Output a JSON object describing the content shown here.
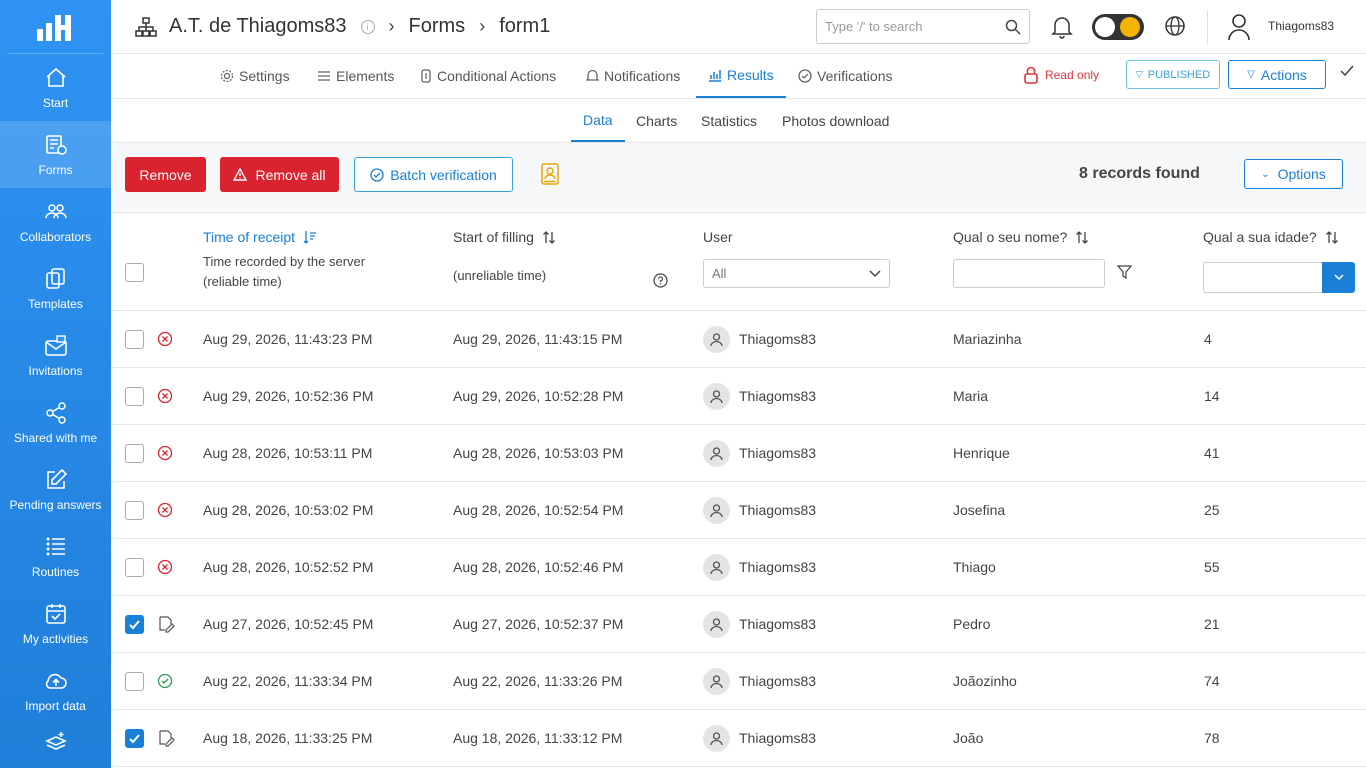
{
  "sidebar": {
    "items": [
      {
        "label": "Start",
        "icon": "home-icon"
      },
      {
        "label": "Forms",
        "icon": "forms-icon"
      },
      {
        "label": "Collaborators",
        "icon": "collaborators-icon"
      },
      {
        "label": "Templates",
        "icon": "templates-icon"
      },
      {
        "label": "Invitations",
        "icon": "invitations-icon"
      },
      {
        "label": "Shared with me",
        "icon": "share-icon"
      },
      {
        "label": "Pending answers",
        "icon": "edit-icon"
      },
      {
        "label": "Routines",
        "icon": "routines-icon"
      },
      {
        "label": "My activities",
        "icon": "calendar-icon"
      },
      {
        "label": "Import data",
        "icon": "cloud-upload-icon"
      }
    ]
  },
  "header": {
    "org": "A.T. de Thiagoms83",
    "crumb1": "Forms",
    "crumb2": "form1",
    "search_placeholder": "Type '/' to search",
    "username": "Thiagoms83"
  },
  "tabs": [
    {
      "label": "Settings"
    },
    {
      "label": "Elements"
    },
    {
      "label": "Conditional Actions"
    },
    {
      "label": "Notifications"
    },
    {
      "label": "Results"
    },
    {
      "label": "Verifications"
    }
  ],
  "status": {
    "read_only": "Read only",
    "published": "PUBLISHED",
    "actions": "Actions"
  },
  "subtabs": [
    {
      "label": "Data"
    },
    {
      "label": "Charts"
    },
    {
      "label": "Statistics"
    },
    {
      "label": "Photos download"
    }
  ],
  "toolbar": {
    "remove": "Remove",
    "remove_all": "Remove all",
    "batch": "Batch verification",
    "records": "8 records found",
    "options": "Options"
  },
  "table": {
    "headers": {
      "time_receipt": "Time of receipt",
      "time_receipt_sub1": "Time recorded by the server",
      "time_receipt_sub2": "(reliable time)",
      "start_filling": "Start of filling",
      "start_filling_sub": "(unreliable time)",
      "user": "User",
      "user_filter": "All",
      "name": "Qual o seu nome?",
      "age": "Qual a sua idade?"
    },
    "rows": [
      {
        "checked": false,
        "status": "rejected",
        "receipt": "Aug 29, 2026, 11:43:23 PM",
        "start": "Aug 29, 2026, 11:43:15 PM",
        "user": "Thiagoms83",
        "name": "Mariazinha",
        "age": "4"
      },
      {
        "checked": false,
        "status": "rejected",
        "receipt": "Aug 29, 2026, 10:52:36 PM",
        "start": "Aug 29, 2026, 10:52:28 PM",
        "user": "Thiagoms83",
        "name": "Maria",
        "age": "14"
      },
      {
        "checked": false,
        "status": "rejected",
        "receipt": "Aug 28, 2026, 10:53:11 PM",
        "start": "Aug 28, 2026, 10:53:03 PM",
        "user": "Thiagoms83",
        "name": "Henrique",
        "age": "41"
      },
      {
        "checked": false,
        "status": "rejected",
        "receipt": "Aug 28, 2026, 10:53:02 PM",
        "start": "Aug 28, 2026, 10:52:54 PM",
        "user": "Thiagoms83",
        "name": "Josefina",
        "age": "25"
      },
      {
        "checked": false,
        "status": "rejected",
        "receipt": "Aug 28, 2026, 10:52:52 PM",
        "start": "Aug 28, 2026, 10:52:46 PM",
        "user": "Thiagoms83",
        "name": "Thiago",
        "age": "55"
      },
      {
        "checked": true,
        "status": "pending",
        "receipt": "Aug 27, 2026, 10:52:45 PM",
        "start": "Aug 27, 2026, 10:52:37 PM",
        "user": "Thiagoms83",
        "name": "Pedro",
        "age": "21"
      },
      {
        "checked": false,
        "status": "approved",
        "receipt": "Aug 22, 2026, 11:33:34 PM",
        "start": "Aug 22, 2026, 11:33:26 PM",
        "user": "Thiagoms83",
        "name": "Joãozinho",
        "age": "74"
      },
      {
        "checked": true,
        "status": "pending",
        "receipt": "Aug 18, 2026, 11:33:25 PM",
        "start": "Aug 18, 2026, 11:33:12 PM",
        "user": "Thiagoms83",
        "name": "João",
        "age": "78"
      }
    ]
  },
  "colors": {
    "accent": "#1a7fd6",
    "sidebar": "#2f93f3",
    "danger": "#d9232e",
    "success": "#2e9c4f"
  }
}
